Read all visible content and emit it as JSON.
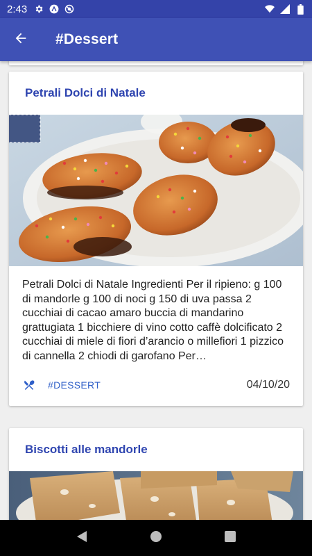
{
  "status_bar": {
    "time": "2:43",
    "icons_left": [
      "gear-icon",
      "app-a-icon",
      "blocked-icon"
    ],
    "icons_right": [
      "wifi-icon",
      "signal-icon",
      "battery-icon"
    ]
  },
  "app_bar": {
    "title": "#Dessert",
    "back_icon": "arrow-back-icon",
    "color": "#3f51b5"
  },
  "cards": [
    {
      "title": "Petrali Dolci di Natale",
      "image": "petrali-pastries-photo",
      "excerpt": "Petrali Dolci di Natale Ingredienti Per il ripieno: g 100 di mandorle g 100 di noci g 150 di uva passa 2 cucchiai di cacao amaro buccia di mandarino grattugiata 1 bicchiere di vino cotto caffè dolcificato 2 cucchiai di miele di fiori d’arancio o millefiori 1 pizzico di cannella 2 chiodi di garofano Per…",
      "tag_icon": "cutlery-icon",
      "tag": "#DESSERT",
      "date": "04/10/20"
    },
    {
      "title": "Biscotti alle mandorle",
      "image": "almond-biscotti-photo"
    }
  ],
  "nav_bar": {
    "icons": [
      "back-triangle-icon",
      "home-circle-icon",
      "recents-square-icon"
    ]
  }
}
